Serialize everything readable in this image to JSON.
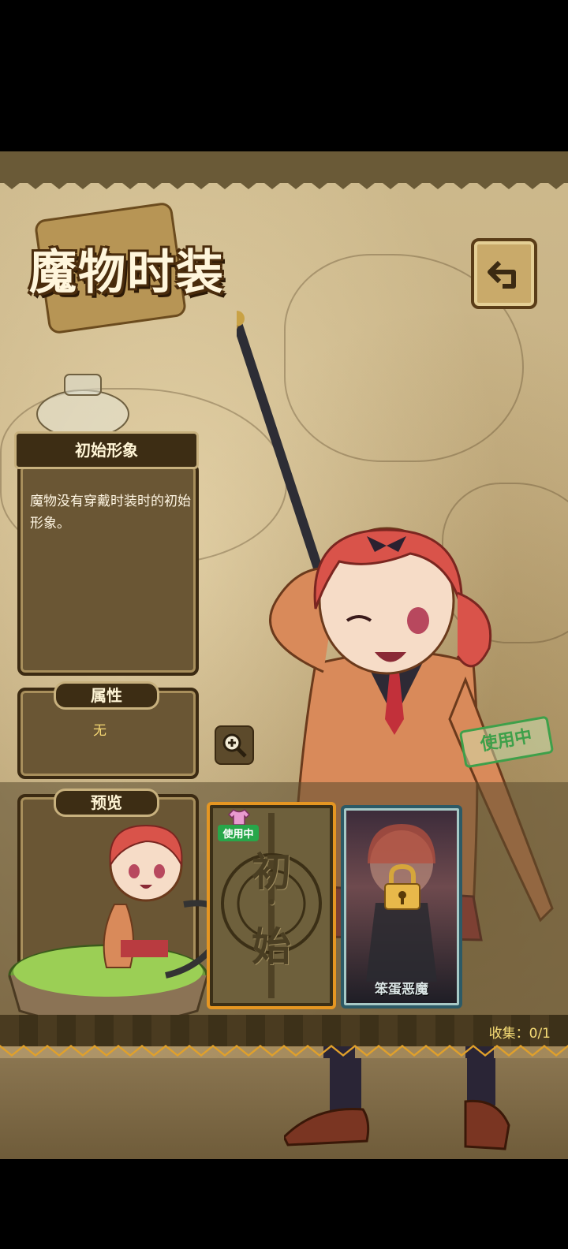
{
  "title": "魔物时装",
  "costume": {
    "name": "初始形象",
    "description": "魔物没有穿戴时装时的初始形象。"
  },
  "attributes": {
    "label": "属性",
    "value": "无"
  },
  "preview": {
    "label": "预览"
  },
  "status_stamp": "使用中",
  "cards": [
    {
      "glyph_top": "初",
      "glyph_mid": "·",
      "glyph_bottom": "始",
      "badge": "使用中",
      "selected": true
    },
    {
      "name": "笨蛋恶魔",
      "locked": true
    }
  ],
  "collection": "收集：0/1",
  "icons": {
    "back": "return-arrow-icon",
    "zoom": "magnify-plus-icon",
    "lock": "padlock-icon",
    "shirt": "shirt-icon"
  },
  "colors": {
    "accent_orange": "#e59622",
    "in_use_green": "#27a74a",
    "collection_text": "#f7dd76"
  }
}
